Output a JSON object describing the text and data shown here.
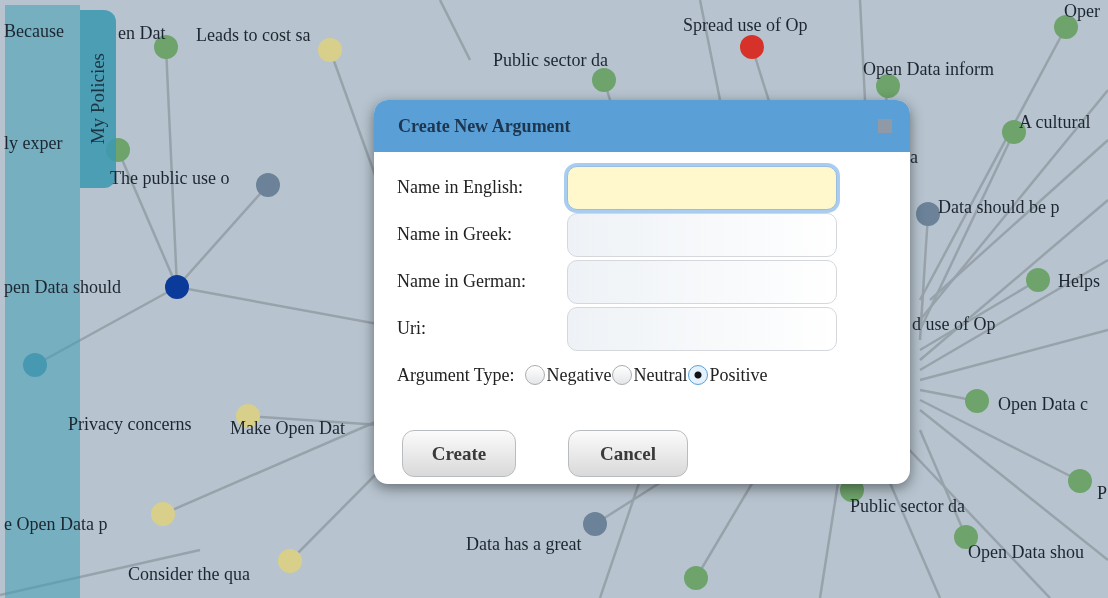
{
  "sidebar": {
    "tab": "My Policies"
  },
  "graph": {
    "nodes": [
      {
        "label": "Because"
      },
      {
        "label": "en Dat",
        "color": "#6ea36b"
      },
      {
        "label": "Leads to cost sa",
        "color": "#d8d08a"
      },
      {
        "label": "Spread use of Op",
        "color": "#d6322a"
      },
      {
        "label": "Oper",
        "color": "#6ea36b"
      },
      {
        "label": "Public sector da",
        "color": "#6ea36b"
      },
      {
        "label": "Open Data inform",
        "color": "#6ea36b"
      },
      {
        "label": "A cultural",
        "color": "#6ea36b"
      },
      {
        "label": "ly exper",
        "color": "#6ea36b"
      },
      {
        "label": "The public use o",
        "color": "#6b8298"
      },
      {
        "label": "a"
      },
      {
        "label": "Data should be p",
        "color": "#6b8298"
      },
      {
        "label": "Helps",
        "color": "#6ea36b"
      },
      {
        "label": "pen Data should",
        "color": "#0a3a9a"
      },
      {
        "label": "d use of Op"
      },
      {
        "color": "#4f93aa"
      },
      {
        "label": "Open Data c",
        "color": "#6ea36b"
      },
      {
        "label": "Privacy concerns"
      },
      {
        "label": "Make Open Dat",
        "color": "#d8d08a"
      },
      {
        "label": "P",
        "color": "#6ea36b"
      },
      {
        "label": "Public sector da",
        "color": "#6ea36b"
      },
      {
        "label": "e Open Data p",
        "color": "#d8d08a"
      },
      {
        "label": "Data has a great",
        "color": "#6b8298"
      },
      {
        "label": "Open Data shou",
        "color": "#6ea36b"
      },
      {
        "label": "Consider the qua",
        "color": "#d8d08a"
      },
      {
        "color": "#6ea36b"
      }
    ]
  },
  "dialog": {
    "title": "Create New Argument",
    "fields": [
      {
        "label": "Name in English:",
        "focused": true
      },
      {
        "label": "Name in Greek:",
        "focused": false
      },
      {
        "label": "Name in German:",
        "focused": false
      },
      {
        "label": "Uri:",
        "focused": false
      }
    ],
    "argument_type": {
      "label": "Argument Type:",
      "options": [
        {
          "label": "Negative",
          "selected": false
        },
        {
          "label": "Neutral",
          "selected": false
        },
        {
          "label": "Positive",
          "selected": true
        }
      ]
    },
    "buttons": [
      "Create",
      "Cancel"
    ]
  }
}
